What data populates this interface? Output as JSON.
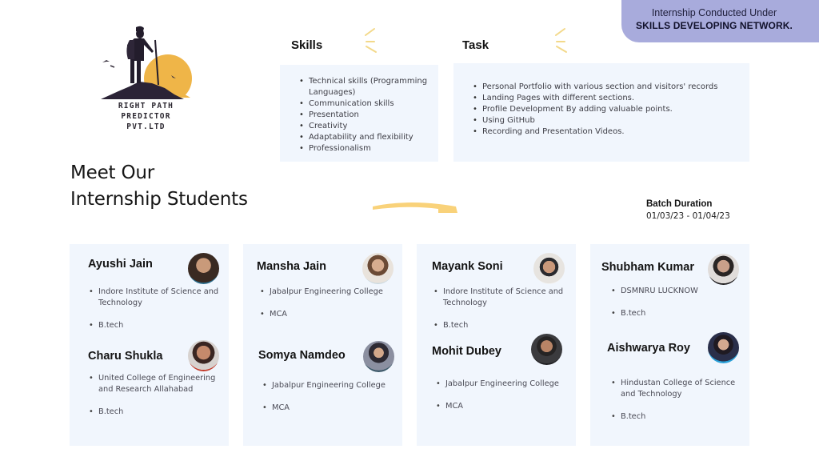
{
  "banner": {
    "line1": "Internship Conducted Under",
    "line2": "SKILLS DEVELOPING NETWORK."
  },
  "logo": {
    "icon": "hiker-on-mountain-sunset-icon",
    "line1": "RIGHT PATH",
    "line2": "PREDICTOR",
    "line3": "PVT.LTD"
  },
  "skills": {
    "title": "Skills",
    "items": [
      "Technical skills (Programming Languages)",
      "Communication skills",
      "Presentation",
      "Creativity",
      "Adaptability and flexibility",
      "Professionalism"
    ]
  },
  "task": {
    "title": "Task",
    "items": [
      "Personal Portfolio with various section and visitors' records",
      "Landing Pages with different sections.",
      "Profile Development By adding valuable points.",
      "Using GitHub",
      "Recording and Presentation Videos."
    ]
  },
  "headline": {
    "line1": "Meet Our",
    "line2": "Internship Students"
  },
  "batch": {
    "label": "Batch Duration",
    "value": "01/03/23 - 01/04/23"
  },
  "colors": {
    "banner": "#a8abdc",
    "panel": "#f1f6fd",
    "accent_yellow": "#f9d27a",
    "sun": "#efb548"
  },
  "cards": [
    {
      "students": [
        {
          "name": "Ayushi Jain",
          "college": "Indore Institute of Science and Technology",
          "degree": "B.tech"
        },
        {
          "name": "Charu Shukla",
          "college": "United College of Engineering and Research Allahabad",
          "degree": "B.tech"
        }
      ]
    },
    {
      "students": [
        {
          "name": "Mansha Jain",
          "college": "Jabalpur Engineering College",
          "degree": "MCA"
        },
        {
          "name": "Somya Namdeo",
          "college": "Jabalpur Engineering College",
          "degree": "MCA"
        }
      ]
    },
    {
      "students": [
        {
          "name": "Mayank Soni",
          "college": "Indore Institute of Science and Technology",
          "degree": "B.tech"
        },
        {
          "name": "Mohit Dubey",
          "college": "Jabalpur Engineering College",
          "degree": "MCA"
        }
      ]
    },
    {
      "students": [
        {
          "name": "Shubham Kumar",
          "college": "DSMNRU LUCKNOW",
          "degree": "B.tech"
        },
        {
          "name": "Aishwarya Roy",
          "college": "Hindustan College of Science and Technology",
          "degree": "B.tech"
        }
      ]
    }
  ]
}
